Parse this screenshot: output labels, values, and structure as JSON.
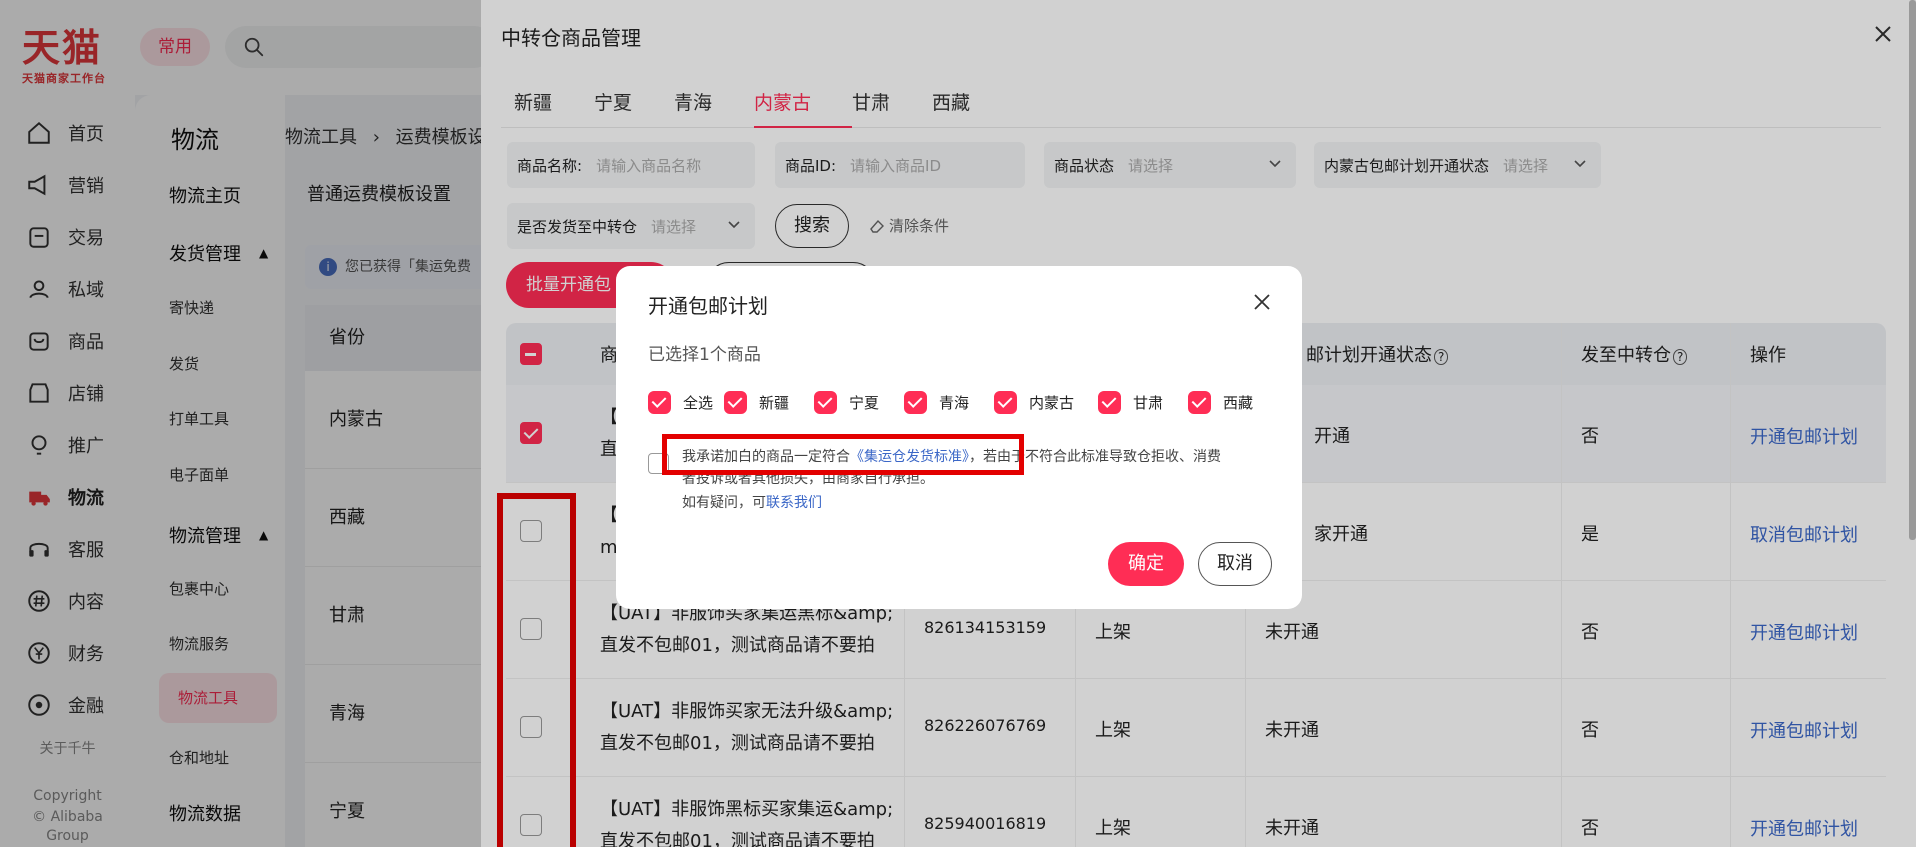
{
  "topbar": {
    "logo_main": "天猫",
    "logo_sub": "天猫商家工作台",
    "frequent_label": "常用"
  },
  "leftnav": {
    "items": [
      {
        "label": "首页",
        "icon": "home-icon"
      },
      {
        "label": "营销",
        "icon": "megaphone-icon"
      },
      {
        "label": "交易",
        "icon": "clipboard-icon"
      },
      {
        "label": "私域",
        "icon": "users-icon"
      },
      {
        "label": "商品",
        "icon": "bag-icon"
      },
      {
        "label": "店铺",
        "icon": "store-icon"
      },
      {
        "label": "推广",
        "icon": "bulb-icon"
      },
      {
        "label": "物流",
        "icon": "truck-icon"
      },
      {
        "label": "客服",
        "icon": "headset-icon"
      },
      {
        "label": "内容",
        "icon": "hash-icon"
      },
      {
        "label": "财务",
        "icon": "yen-icon"
      },
      {
        "label": "金融",
        "icon": "target-icon"
      }
    ],
    "about": "关于千牛",
    "copyright": "Copyright",
    "copyright2": "© Alibaba",
    "copyright3": "Group"
  },
  "subnav": {
    "title": "物流",
    "home": "物流主页",
    "group1": "发货管理",
    "g1_items": [
      "寄快递",
      "发货",
      "打单工具",
      "电子面单"
    ],
    "group2": "物流管理",
    "g2_items": [
      "包裹中心",
      "物流服务",
      "物流工具",
      "仓和地址"
    ],
    "group3": "物流数据"
  },
  "main": {
    "breadcrumb1": "物流工具",
    "breadcrumb_sep": "›",
    "breadcrumb2": "运费模板设",
    "tab": "普通运费模板设置",
    "info": "您已获得「集运免费",
    "table_head": "省份",
    "provinces": [
      "内蒙古",
      "西藏",
      "甘肃",
      "青海",
      "宁夏"
    ]
  },
  "drawer": {
    "title": "中转仓商品管理",
    "tabs": [
      "新疆",
      "宁夏",
      "青海",
      "内蒙古",
      "甘肃",
      "西藏"
    ],
    "active_tab": "内蒙古",
    "filters": {
      "name_label": "商品名称:",
      "name_ph": "请输入商品名称",
      "id_label": "商品ID:",
      "id_ph": "请输入商品ID",
      "status_label": "商品状态",
      "status_ph": "请选择",
      "plan_label": "内蒙古包邮计划开通状态",
      "plan_ph": "请选择",
      "ship_label": "是否发货至中转仓",
      "ship_ph": "请选择"
    },
    "search_label": "搜索",
    "clear_label": "清除条件",
    "batch_label": "批量开通包",
    "table": {
      "headers": {
        "product": "商",
        "plan_status": "邮计划开通状态",
        "to_transit": "发至中转仓",
        "action": "操作"
      },
      "rows": [
        {
          "product1": "【",
          "product2": "直",
          "id": "",
          "status": "",
          "plan": "开通",
          "transit": "否",
          "action": "开通包邮计划",
          "checked": true
        },
        {
          "product1": "【",
          "product2": "m",
          "id": "",
          "status": "",
          "plan": "家开通",
          "transit": "是",
          "action": "取消包邮计划",
          "checked": false
        },
        {
          "product1": "【UAT】非服饰买家集运黑标&amp;",
          "product2": "直发不包邮01，测试商品请不要拍",
          "id": "826134153159",
          "status": "上架",
          "plan": "未开通",
          "transit": "否",
          "action": "开通包邮计划",
          "checked": false
        },
        {
          "product1": "【UAT】非服饰买家无法升级&amp;",
          "product2": "直发不包邮01，测试商品请不要拍",
          "id": "826226076769",
          "status": "上架",
          "plan": "未开通",
          "transit": "否",
          "action": "开通包邮计划",
          "checked": false
        },
        {
          "product1": "【UAT】非服饰黑标买家集运&amp;",
          "product2": "直发不包邮01，测试商品请不要拍",
          "id": "825940016819",
          "status": "上架",
          "plan": "未开通",
          "transit": "否",
          "action": "开通包邮计划",
          "checked": false
        }
      ]
    }
  },
  "modal": {
    "title": "开通包邮计划",
    "selected_text": "已选择1个商品",
    "regions": [
      "全选",
      "新疆",
      "宁夏",
      "青海",
      "内蒙古",
      "甘肃",
      "西藏"
    ],
    "agree_prefix": "我承诺加白的商品一定符合",
    "agree_link": "《集运仓发货标准》",
    "agree_suffix": "，若由于不符合此标准导致仓拒收、消费",
    "agree_line2": "者投诉或者其他损失，由商家自行承担。",
    "help_prefix": "如有疑问，可",
    "help_link": "联系我们",
    "ok_label": "确定",
    "cancel_label": "取消"
  },
  "colors": {
    "accent": "#ff2d55",
    "link": "#3b67c7",
    "highlight": "#e30000"
  }
}
